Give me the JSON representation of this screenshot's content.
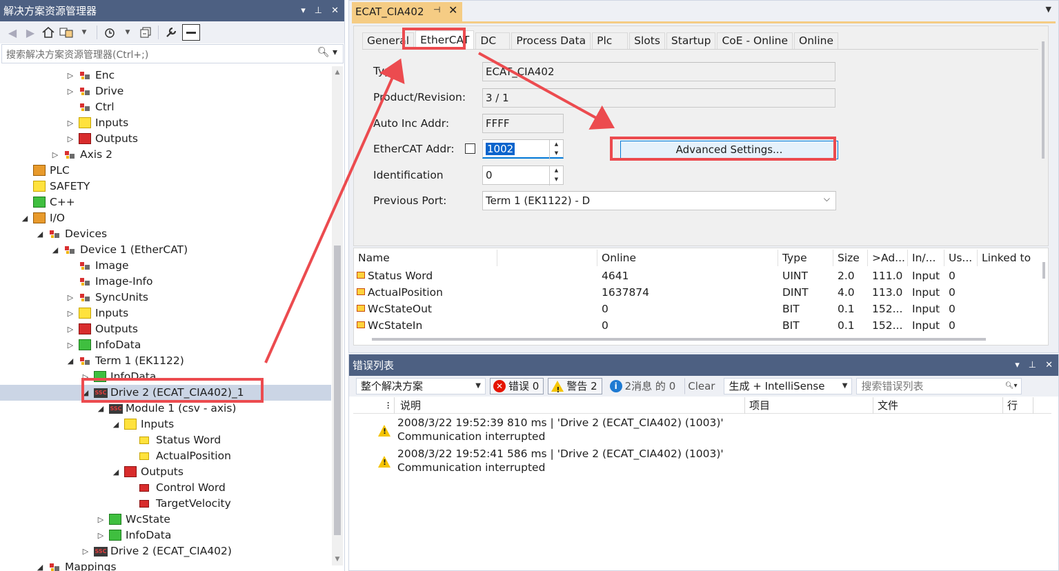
{
  "solution_explorer": {
    "title": "解决方案资源管理器",
    "controls": [
      "▾",
      "⊥",
      "✕"
    ],
    "search_placeholder": "搜索解决方案资源管理器(Ctrl+;)",
    "tree": [
      {
        "label": "Enc",
        "indent": 3,
        "expander": "▷",
        "icon": "enc-icon"
      },
      {
        "label": "Drive",
        "indent": 3,
        "expander": "▷",
        "icon": "drive-icon"
      },
      {
        "label": "Ctrl",
        "indent": 3,
        "expander": "",
        "icon": "ctrl-icon"
      },
      {
        "label": "Inputs",
        "indent": 3,
        "expander": "▷",
        "icon": "inputs-icon"
      },
      {
        "label": "Outputs",
        "indent": 3,
        "expander": "▷",
        "icon": "outputs-icon"
      },
      {
        "label": "Axis 2",
        "indent": 2,
        "expander": "▷",
        "icon": "axis-icon"
      },
      {
        "label": "PLC",
        "indent": 0,
        "expander": "",
        "icon": "plc-icon"
      },
      {
        "label": "SAFETY",
        "indent": 0,
        "expander": "",
        "icon": "safety-icon"
      },
      {
        "label": "C++",
        "indent": 0,
        "expander": "",
        "icon": "cpp-icon"
      },
      {
        "label": "I/O",
        "indent": 0,
        "expander": "◢",
        "icon": "io-icon"
      },
      {
        "label": "Devices",
        "indent": 1,
        "expander": "◢",
        "icon": "devices-icon"
      },
      {
        "label": "Device 1 (EtherCAT)",
        "indent": 2,
        "expander": "◢",
        "icon": "ethercat-device-icon"
      },
      {
        "label": "Image",
        "indent": 3,
        "expander": "",
        "icon": "image-icon"
      },
      {
        "label": "Image-Info",
        "indent": 3,
        "expander": "",
        "icon": "image-info-icon"
      },
      {
        "label": "SyncUnits",
        "indent": 3,
        "expander": "▷",
        "icon": "syncunits-icon"
      },
      {
        "label": "Inputs",
        "indent": 3,
        "expander": "▷",
        "icon": "inputs-icon"
      },
      {
        "label": "Outputs",
        "indent": 3,
        "expander": "▷",
        "icon": "outputs-icon"
      },
      {
        "label": "InfoData",
        "indent": 3,
        "expander": "▷",
        "icon": "infodata-icon"
      },
      {
        "label": "Term 1 (EK1122)",
        "indent": 3,
        "expander": "◢",
        "icon": "terminal-icon"
      },
      {
        "label": "InfoData",
        "indent": 4,
        "expander": "▷",
        "icon": "infodata-icon"
      },
      {
        "label": "Drive 2 (ECAT_CIA402)_1",
        "indent": 4,
        "expander": "◢",
        "icon": "ssc-drive-icon",
        "selected": true
      },
      {
        "label": "Module 1 (csv -  axis)",
        "indent": 5,
        "expander": "◢",
        "icon": "ssc-module-icon"
      },
      {
        "label": "Inputs",
        "indent": 6,
        "expander": "◢",
        "icon": "inputs-icon"
      },
      {
        "label": "Status Word",
        "indent": 7,
        "expander": "",
        "icon": "input-variable-icon"
      },
      {
        "label": "ActualPosition",
        "indent": 7,
        "expander": "",
        "icon": "input-variable-icon"
      },
      {
        "label": "Outputs",
        "indent": 6,
        "expander": "◢",
        "icon": "outputs-icon"
      },
      {
        "label": "Control Word",
        "indent": 7,
        "expander": "",
        "icon": "output-variable-icon"
      },
      {
        "label": "TargetVelocity",
        "indent": 7,
        "expander": "",
        "icon": "output-variable-icon"
      },
      {
        "label": "WcState",
        "indent": 5,
        "expander": "▷",
        "icon": "wcstate-icon"
      },
      {
        "label": "InfoData",
        "indent": 5,
        "expander": "▷",
        "icon": "infodata-icon"
      },
      {
        "label": "Drive 2 (ECAT_CIA402)",
        "indent": 4,
        "expander": "▷",
        "icon": "ssc-drive-icon"
      },
      {
        "label": "Mappings",
        "indent": 1,
        "expander": "◢",
        "icon": "mappings-icon"
      }
    ]
  },
  "editor": {
    "doc_tab": "ECAT_CIA402",
    "tabs": [
      "General",
      "EtherCAT",
      "DC",
      "Process Data",
      "Plc",
      "Slots",
      "Startup",
      "CoE - Online",
      "Online"
    ],
    "active_tab": "EtherCAT",
    "fields": {
      "type_label": "Type:",
      "type_value": "ECAT_CIA402",
      "product_label": "Product/Revision:",
      "product_value": "3 / 1",
      "autoinc_label": "Auto Inc Addr:",
      "autoinc_value": "FFFF",
      "ecaddr_label": "EtherCAT Addr:",
      "ecaddr_value": "1002",
      "ident_label": "Identification",
      "ident_value": "0",
      "prevport_label": "Previous Port:",
      "prevport_value": "Term 1 (EK1122) - D"
    },
    "advanced_button": "Advanced Settings...",
    "grid": {
      "headers": [
        "Name",
        "",
        "Online",
        "Type",
        "Size",
        ">Ad...",
        "In/...",
        "Us...",
        "Linked to"
      ],
      "rows": [
        {
          "name": "Status Word",
          "online": "4641",
          "type": "UINT",
          "size": "2.0",
          "addr": "111.0",
          "io": "Input",
          "user": "0"
        },
        {
          "name": "ActualPosition",
          "online": "1637874",
          "type": "DINT",
          "size": "4.0",
          "addr": "113.0",
          "io": "Input",
          "user": "0"
        },
        {
          "name": "WcStateOut",
          "online": "0",
          "type": "BIT",
          "size": "0.1",
          "addr": "152...",
          "io": "Input",
          "user": "0"
        },
        {
          "name": "WcStateIn",
          "online": "0",
          "type": "BIT",
          "size": "0.1",
          "addr": "152...",
          "io": "Input",
          "user": "0"
        }
      ]
    }
  },
  "error_list": {
    "title": "错误列表",
    "scope": "整个解决方案",
    "errors": "错误 0",
    "warnings": "警告 2",
    "messages": "2消息 的 0",
    "clear": "Clear",
    "build_filter": "生成 + IntelliSense",
    "search_placeholder": "搜索错误列表",
    "headers": [
      "说明",
      "项目",
      "文件",
      "行"
    ],
    "rows": [
      {
        "line1": "2008/3/22 19:52:39 810 ms  | 'Drive 2 (ECAT_CIA402) (1003)'",
        "line2": "Communication interrupted"
      },
      {
        "line1": "2008/3/22 19:52:41 586 ms  | 'Drive 2 (ECAT_CIA402) (1003)'",
        "line2": "Communication interrupted"
      }
    ]
  },
  "colors": {
    "titlebar": "#4d6082",
    "doc_tab": "#f5cc84",
    "annotation_red": "#ec4b4f",
    "selection": "#cbd5e5"
  }
}
